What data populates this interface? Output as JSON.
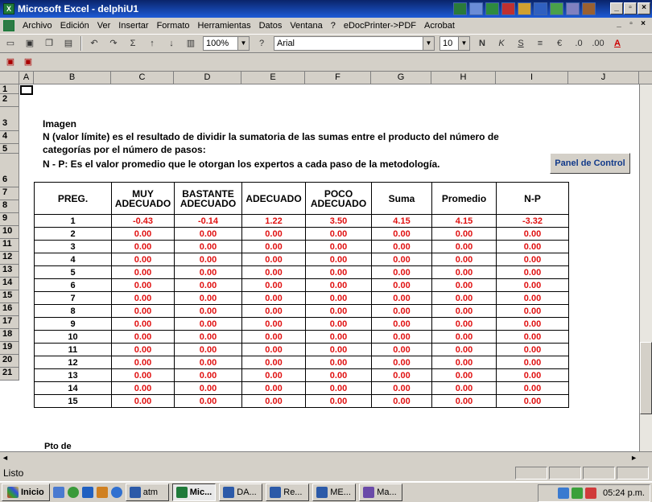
{
  "window": {
    "title": "Microsoft Excel - delphiU1"
  },
  "menu": [
    "Archivo",
    "Edición",
    "Ver",
    "Insertar",
    "Formato",
    "Herramientas",
    "Datos",
    "Ventana",
    "?",
    "eDocPrinter->PDF",
    "Acrobat"
  ],
  "toolbar": {
    "zoom": "100%",
    "font": "Arial",
    "size": "10"
  },
  "columns": [
    "A",
    "B",
    "C",
    "D",
    "E",
    "F",
    "G",
    "H",
    "I",
    "J"
  ],
  "rows": [
    "1",
    "2",
    "3",
    "4",
    "5",
    "6",
    "7",
    "8",
    "9",
    "10",
    "11",
    "12",
    "13",
    "14",
    "15",
    "16",
    "17",
    "18",
    "19",
    "20",
    "21"
  ],
  "sheet": {
    "b2": "Imagen",
    "b3a": "N (valor límite) es el resultado de dividir la sumatoria de las sumas entre el producto del número de",
    "b3b": "categorías por el número de pasos:",
    "b4": "N - P: Es el valor promedio que le otorgan los expertos a cada paso de la metodología.",
    "panel_button": "Panel de Control",
    "pto": "Pto de"
  },
  "table": {
    "headers": [
      "PREG.",
      "MUY ADECUADO",
      "BASTANTE ADECUADO",
      "ADECUADO",
      "POCO ADECUADO",
      "Suma",
      "Promedio",
      "N-P"
    ],
    "rows": [
      [
        "1",
        "-0.43",
        "-0.14",
        "1.22",
        "3.50",
        "4.15",
        "4.15",
        "-3.32"
      ],
      [
        "2",
        "0.00",
        "0.00",
        "0.00",
        "0.00",
        "0.00",
        "0.00",
        "0.00"
      ],
      [
        "3",
        "0.00",
        "0.00",
        "0.00",
        "0.00",
        "0.00",
        "0.00",
        "0.00"
      ],
      [
        "4",
        "0.00",
        "0.00",
        "0.00",
        "0.00",
        "0.00",
        "0.00",
        "0.00"
      ],
      [
        "5",
        "0.00",
        "0.00",
        "0.00",
        "0.00",
        "0.00",
        "0.00",
        "0.00"
      ],
      [
        "6",
        "0.00",
        "0.00",
        "0.00",
        "0.00",
        "0.00",
        "0.00",
        "0.00"
      ],
      [
        "7",
        "0.00",
        "0.00",
        "0.00",
        "0.00",
        "0.00",
        "0.00",
        "0.00"
      ],
      [
        "8",
        "0.00",
        "0.00",
        "0.00",
        "0.00",
        "0.00",
        "0.00",
        "0.00"
      ],
      [
        "9",
        "0.00",
        "0.00",
        "0.00",
        "0.00",
        "0.00",
        "0.00",
        "0.00"
      ],
      [
        "10",
        "0.00",
        "0.00",
        "0.00",
        "0.00",
        "0.00",
        "0.00",
        "0.00"
      ],
      [
        "11",
        "0.00",
        "0.00",
        "0.00",
        "0.00",
        "0.00",
        "0.00",
        "0.00"
      ],
      [
        "12",
        "0.00",
        "0.00",
        "0.00",
        "0.00",
        "0.00",
        "0.00",
        "0.00"
      ],
      [
        "13",
        "0.00",
        "0.00",
        "0.00",
        "0.00",
        "0.00",
        "0.00",
        "0.00"
      ],
      [
        "14",
        "0.00",
        "0.00",
        "0.00",
        "0.00",
        "0.00",
        "0.00",
        "0.00"
      ],
      [
        "15",
        "0.00",
        "0.00",
        "0.00",
        "0.00",
        "0.00",
        "0.00",
        "0.00"
      ]
    ]
  },
  "status": {
    "text": "Listo"
  },
  "taskbar": {
    "start": "Inicio",
    "tasks": [
      "atm",
      "Mic...",
      "DA...",
      "Re...",
      "ME...",
      "Ma..."
    ],
    "active_index": 1,
    "clock": "05:24 p.m."
  },
  "colors": {
    "value_red": "#e01010",
    "title_blue": "#0a246a"
  }
}
